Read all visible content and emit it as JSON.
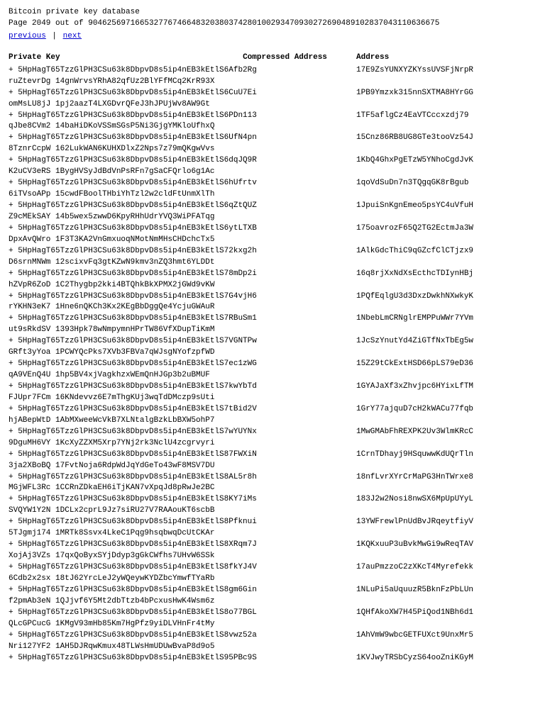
{
  "header": {
    "title": "Bitcoin private key database",
    "page_info": "Page 2049 out of 904625697166532776746648320380374280100293470930272690489102837043110636675",
    "nav": {
      "previous": "previous",
      "separator": " | ",
      "next": "next"
    }
  },
  "columns": {
    "private_key": "Private Key",
    "compressed_address": "Compressed Address",
    "address": "Address"
  },
  "entries": [
    {
      "key_line1": "+ 5HpHagT65TzzGlPH3CSu63k8DbpvD8s5ip4nEB3kEtlS6Afb2Rg",
      "key_line2": "ruZtevrDg 14gnWrvsYRhA82qfUz2BlYFfMCq2KrR93X",
      "compressed": "",
      "address": "17E9ZsYUNXYZKYssUVSFjNrpR"
    },
    {
      "key_line1": "+ 5HpHagT65TzzGlPH3CSu63k8DbpvD8s5ip4nEB3kEtlS6CuU7Ei",
      "key_line2": "omMsLU8jJ  1pj2aazT4LXGDvrQFeJ3hJPUjWv8AW9Gt",
      "compressed": "",
      "address": "1PB9Ymzxk315nnSXTMA8HYrGG"
    },
    {
      "key_line1": "+ 5HpHagT65TzzGlPH3CSu63k8DbpvD8s5ip4nEB3kEtlS6PDn113",
      "key_line2": "qJbe8CVm2 14baHiDKoVSSmSGsP5Ni3GjgYMKloUfhxQ",
      "compressed": "",
      "address": "1TF5aflgCz4EaVTCccxzdj79"
    },
    {
      "key_line1": "+ 5HpHagT65TzzGlPH3CSu63k8DbpvD8s5ip4nEB3kEtlS6UfN4pn",
      "key_line2": "8TznrCcpW 162LukWAN6KUHXDlxZ2Nps7z79mQKgwVvs",
      "compressed": "",
      "address": "15Cnz86RB8UG8GTe3tooVz54J"
    },
    {
      "key_line1": "+ 5HpHagT65TzzGlPH3CSu63k8DbpvD8s5ip4nEB3kEtlS6dqJQ9R",
      "key_line2": "K2uCV3eRS 1BygHVSyJdBdVnPsRFn7gSaCFQrlo6g1Ac",
      "compressed": "",
      "address": "1KbQ4GhxPgETzW5YNhoCgdJvK"
    },
    {
      "key_line1": "+ 5HpHagT65TzzGlPH3CSu63k8DbpvD8s5ip4nEB3kEtlS6hUfrtv",
      "key_line2": "6iTVsoAPp 15cwdFBoolTHbiYhTzl2w2cldFtUnmXlTh",
      "compressed": "",
      "address": "1qoVdSuDn7n3TQgqGK8rBgub"
    },
    {
      "key_line1": "+ 5HpHagT65TzzGlPH3CSu63k8DbpvD8s5ip4nEB3kEtlS6qZtQUZ",
      "key_line2": "Z9cMEkSAY 14b5wex5zwwD6KpyRHhUdrYVQ3WiPFATqg",
      "compressed": "",
      "address": "1JpuiSnKgnEmeo5psYC4uVfuH"
    },
    {
      "key_line1": "+ 5HpHagT65TzzGlPH3CSu63k8DbpvD8s5ip4nEB3kEtlS6ytLTXB",
      "key_line2": "DpxAvQWro 1F3T3KA2VnGmxuoqNMotNmMHsCHDchcTx5",
      "compressed": "",
      "address": "175oavrozF65Q2TG2EctmJa3W"
    },
    {
      "key_line1": "+ 5HpHagT65TzzGlPH3CSu63k8DbpvD8s5ip4nEB3kEtlS72kxg2h",
      "key_line2": "D6srnMNWm 12scixvFq3gtKZwN9kmv3nZQ3hmt6YLDDt",
      "compressed": "",
      "address": "1AlkGdcThiC9qGZcfClCTjzx9"
    },
    {
      "key_line1": "+ 5HpHagT65TzzGlPH3CSu63k8DbpvD8s5ip4nEB3kEtlS78mDp2i",
      "key_line2": "hZVpR6ZoD 1C2Thygbp2kki4BTQhkBkXPMX2jGWd9vKW",
      "compressed": "",
      "address": "16q8rjXxNdXsEcthcTDIynHBj"
    },
    {
      "key_line1": "+ 5HpHagT65TzzGlPH3CSu63k8DbpvD8s5ip4nEB3kEtlS7G4vjH6",
      "key_line2": "rYKHN3eK7 1Hne6nQKCh3Kx2KEgBbDggQe4YcjuGWAuR",
      "compressed": "",
      "address": "1PQfEqlgU3d3DxzDwkhNXwkyK"
    },
    {
      "key_line1": "+ 5HpHagT65TzzGlPH3CSu63k8DbpvD8s5ip4nEB3kEtlS7RBuSm1",
      "key_line2": "ut9sRkdSV 1393Hpk78wNmpymnHPrTW86VfXDupTiKmM",
      "compressed": "",
      "address": "1NbebLmCRNglrEMPPuWWr7YVm"
    },
    {
      "key_line1": "+ 5HpHagT65TzzGlPH3CSu63k8DbpvD8s5ip4nEB3kEtlS7VGNTPw",
      "key_line2": "GRft3yYoa 1PCWYQcPks7XVb3FBVa7qWJsgNYofzpfWD",
      "compressed": "",
      "address": "1JcSzYnutYd4ZiGTfNxTbEg5w"
    },
    {
      "key_line1": "+ 5HpHagT65TzzGlPH3CSu63k8DbpvD8s5ip4nEB3kEtlS7ec1zWG",
      "key_line2": "qA9VEnQ4U 1hp5BV4xjVagkhzxWEmQnHJGp3b2uBMUF",
      "compressed": "",
      "address": "15Z29tCkExtHSD66pLS79eD36"
    },
    {
      "key_line1": "+ 5HpHagT65TzzGlPH3CSu63k8DbpvD8s5ip4nEB3kEtlS7kwYbTd",
      "key_line2": "FJUpr7FCm 16KNdevvz6E7mThgKUj3wqTdDMczp9sUti",
      "compressed": "",
      "address": "1GYAJaXf3xZhvjpc6HYixLfTM"
    },
    {
      "key_line1": "+ 5HpHagT65TzzGlPH3CSu63k8DbpvD8s5ip4nEB3kEtlS7tBid2V",
      "key_line2": "hjABepWtD 1AbMXweeWcVkB7XLNtalgBzkLbBXW5ohP7",
      "compressed": "",
      "address": "1GrY77ajquD7cH2kWACu77fqb"
    },
    {
      "key_line1": "+ 5HpHagT65TzzGlPH3CSu63k8DbpvD8s5ip4nEB3kEtlS7wYUYNx",
      "key_line2": "9DguMH6VY 1KcXyZZXM5Xrp7YNj2rk3NclU4zcgrvyri",
      "compressed": "",
      "address": "1MwGMAbFhREXPK2Uv3WlmKRcC"
    },
    {
      "key_line1": "+ 5HpHagT65TzzGlPH3CSu63k8DbpvD8s5ip4nEB3kEtlS87FWXiN",
      "key_line2": "3ja2XBoBQ 17FvtNoja6RdpWdJqYdGeTo43wF8MSV7DU",
      "compressed": "",
      "address": "1CrnTDhayj9HSquwwKdUQrTln"
    },
    {
      "key_line1": "+ 5HpHagT65TzzGlPH3CSu63k8DbpvD8s5ip4nEB3kEtlS8AL5r8h",
      "key_line2": "MGjWFL3Rc 1CCRnZDkaEH6iTjKAN7vXpqJd8pRwJe2BC",
      "compressed": "",
      "address": "18nfLvrXYrCrMaPG3HnTWrxe8"
    },
    {
      "key_line1": "+ 5HpHagT65TzzGlPH3CSu63k8DbpvD8s5ip4nEB3kEtlS8KY7iMs",
      "key_line2": "SVQYW1Y2N 1DCLx2cprL9Jz7siRU27V7RAAouKT6scbB",
      "compressed": "",
      "address": "183J2w2Nosi8nwSX6MpUpUYyL"
    },
    {
      "key_line1": "+ 5HpHagT65TzzGlPH3CSu63k8DbpvD8s5ip4nEB3kEtlS8Pfknui",
      "key_line2": "5TJgmj174 1MRTk8Ssvx4LkeC1Pqg9hsqbwqDcUtCKAr",
      "compressed": "",
      "address": "13YWFrewlPnUdBvJRqeytfiyV"
    },
    {
      "key_line1": "+ 5HpHagT65TzzGlPH3CSu63k8DbpvD8s5ip4nEB3kEtlS8XRqm7J",
      "key_line2": "XojAj3VZs 17qxQoByxSYjDdyp3gGkCWfhs7UHvW6SSk",
      "compressed": "",
      "address": "1KQKxuuP3uBvkMwGi9wReqTAV"
    },
    {
      "key_line1": "+ 5HpHagT65TzzGlPH3CSu63k8DbpvD8s5ip4nEB3kEtlS8fkYJ4V",
      "key_line2": "6Cdb2x2sx 18tJ62YrcLeJ2yWQeywKYDZbcYmwfTYaRb",
      "compressed": "",
      "address": "17auPmzzoC2zXKcT4Myrefekk"
    },
    {
      "key_line1": "+ 5HpHagT65TzzGlPH3CSu63k8DbpvD8s5ip4nEB3kEtlS8gm6Gin",
      "key_line2": "f2pmAb3eN 1QJjvf6Y5Mt2dbTtzb4bPcxusHwK4Wsm6z",
      "compressed": "",
      "address": "1NLuPi5aUquuzR5BknFzPbLUn"
    },
    {
      "key_line1": "+ 5HpHagT65TzzGlPH3CSu63k8DbpvD8s5ip4nEB3kEtlS8o77BGL",
      "key_line2": "QLcGPCucG 1KMgV93mHb85Km7HgPfz9yiDLVHnFr4tMy",
      "compressed": "",
      "address": "1QHfAkoXW7H45PiQod1NBh6d1"
    },
    {
      "key_line1": "+ 5HpHagT65TzzGlPH3CSu63k8DbpvD8s5ip4nEB3kEtlS8vwz52a",
      "key_line2": "Nri127YF2 1AH5DJRqwKmux48TLWsHmUDUwBvaP8d9o5",
      "compressed": "",
      "address": "1AhVmW9wbcGETFUXct9UnxMr5"
    },
    {
      "key_line1": "+ 5HpHagT65TzzGlPH3CSu63k8DbpvD8s5ip4nEB3kEtlS95PBc9S",
      "key_line2": "",
      "compressed": "",
      "address": "1KVJwyTRSbCyzS64ooZniKGyM"
    }
  ]
}
